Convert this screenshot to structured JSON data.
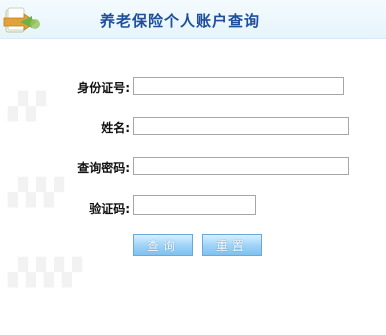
{
  "header": {
    "title": "养老保险个人账户查询",
    "icon": "folder-arrow-icon"
  },
  "form": {
    "id_label": "身份证号:",
    "name_label": "姓名:",
    "password_label": "查询密码:",
    "captcha_label": "验证码:",
    "id_value": "",
    "name_value": "",
    "password_value": "",
    "captcha_value": ""
  },
  "buttons": {
    "query_label": "查询",
    "reset_label": "重置"
  },
  "colors": {
    "title": "#1f4f9a",
    "button": "#8fcaf3",
    "header_bg": "#e6f4fc"
  }
}
